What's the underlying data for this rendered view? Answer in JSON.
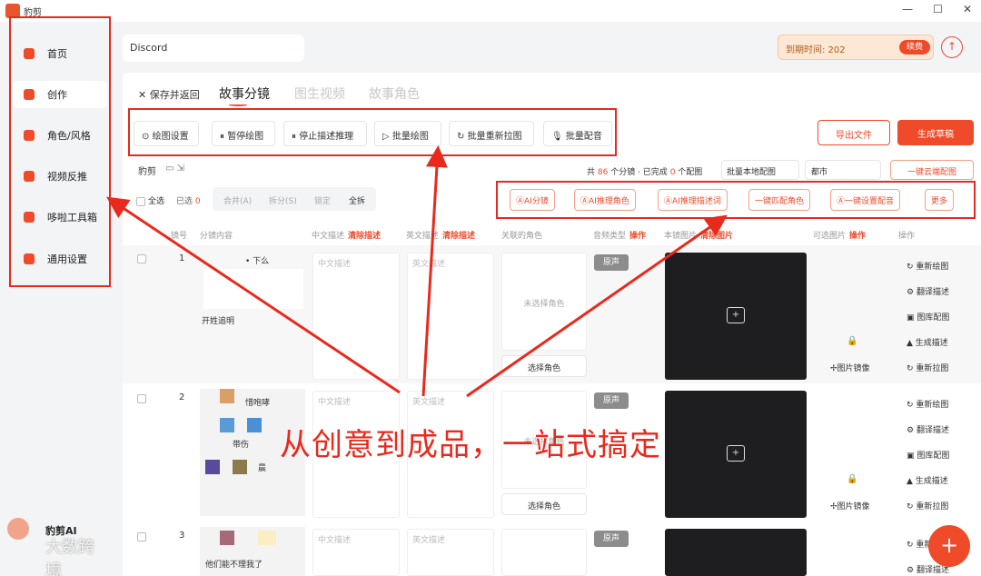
{
  "window": {
    "title": "豹剪",
    "controls": [
      "—",
      "☐",
      "✕"
    ]
  },
  "sidebar": {
    "items": [
      {
        "label": "首页",
        "icon": "lightning-icon"
      },
      {
        "label": "创作",
        "icon": "palette-icon"
      },
      {
        "label": "角色/风格",
        "icon": "user-icon"
      },
      {
        "label": "视频反推",
        "icon": "rewind-icon"
      },
      {
        "label": "哆啦工具箱",
        "icon": "toolbox-icon"
      },
      {
        "label": "通用设置",
        "icon": "settings-icon"
      }
    ],
    "footer_label": "豹剪AI",
    "watermark": "大数跨境"
  },
  "header": {
    "name_value": "Discord",
    "expiry_text": "到期时间: 202",
    "renew_label": "续费"
  },
  "main": {
    "back_label": "✕ 保存并返回",
    "tabs": [
      "故事分镜",
      "图生视频",
      "故事角色"
    ],
    "toolbar": [
      "绘图设置",
      "暂停绘图",
      "停止描述推理",
      "批量绘图",
      "批量重新拉图",
      "批量配音"
    ],
    "toolbar_icons": [
      "⊙",
      "⏸",
      "⏸",
      "▷",
      "↻",
      "🎙"
    ],
    "export_label": "导出文件",
    "draft_label": "生成草稿",
    "project_label": "豹剪",
    "summary": {
      "prefix": "共",
      "total": "86",
      "mid": "个分镜 · 已完成",
      "done": "0",
      "suffix": "个配图"
    },
    "batch_local_label": "批量本地配图",
    "city_value": "都市",
    "cloud_label": "一键云端配图",
    "select_all": "全选",
    "selected_prefix": "已选",
    "selected_count": "0",
    "segments": [
      "合并(A)",
      "拆分(S)",
      "锁定",
      "全拆"
    ],
    "ai_buttons": [
      "AI分镜",
      "AI推理角色",
      "AI推理描述词",
      "一键匹配角色",
      "一键设置配音",
      "更多"
    ]
  },
  "table": {
    "headers": {
      "num": "镜号",
      "content": "分镜内容",
      "cn": "中文描述",
      "cn_action": "清除描述",
      "en": "英文描述",
      "en_action": "清除描述",
      "role": "关联的角色",
      "audio": "音频类型",
      "audio_action": "操作",
      "image": "本镜图片",
      "image_action": "清除图片",
      "optional": "可选图片",
      "optional_action": "操作",
      "ops": "操作"
    },
    "rows": [
      {
        "num": "1",
        "content_top": "• 下么",
        "content_bottom": "开姓追明",
        "cn_placeholder": "中文描述",
        "en_placeholder": "英文描述",
        "role_empty": "未选择角色",
        "role_button": "选择角色",
        "voice": "原声",
        "mirror": "图片镜像"
      },
      {
        "num": "2",
        "content_top": "惜咆哮",
        "content_mid": "带伤",
        "content_bottom": "晨",
        "cn_placeholder": "中文描述",
        "en_placeholder": "英文描述",
        "role_empty": "未选择角色",
        "role_button": "选择角色",
        "voice": "原声",
        "mirror": "图片镜像"
      },
      {
        "num": "3",
        "content_bottom": "他们能不理我了",
        "cn_placeholder": "中文描述",
        "en_placeholder": "英文描述",
        "voice": "原声"
      }
    ],
    "ops": [
      "重新绘图",
      "翻译描述",
      "图库配图",
      "生成描述",
      "重新拉图"
    ]
  },
  "overlay_caption": "从创意到成品，一站式搞定",
  "colors": {
    "accent": "#ef4b2b",
    "annotation": "#e8291c"
  }
}
